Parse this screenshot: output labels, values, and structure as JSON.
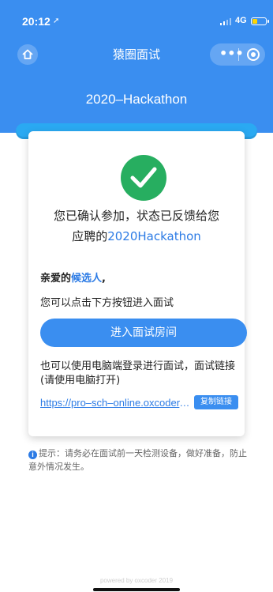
{
  "status_bar": {
    "time": "20:12",
    "network": "4G",
    "battery_level": 0.35
  },
  "nav": {
    "title": "猿圈面试",
    "home_icon": "home-icon",
    "more_icon": "more-dots-icon",
    "close_icon": "target-icon",
    "more_glyph": "•••"
  },
  "header": {
    "event_title": "2020–Hackathon"
  },
  "card": {
    "confirm_line1": "您已确认参加，状态已反馈给您",
    "confirm_prefix": "应聘的",
    "confirm_event": "2020Hackathon",
    "greeting_prefix": "亲爱的",
    "greeting_name": "候选人",
    "greeting_suffix": ",",
    "hint": "您可以点击下方按钮进入面试",
    "enter_button": "进入面试房间",
    "pc_note": "也可以使用电脑端登录进行面试，面试链接(请使用电脑打开)",
    "link_text": "https://pro–sch–online.oxcoder.com",
    "copy_button": "复制链接"
  },
  "tip": {
    "text": "提示：请务必在面试前一天检测设备，做好准备，防止意外情况发生。"
  },
  "footer": {
    "powered": "powered by oxcoder 2019"
  },
  "colors": {
    "primary": "#3a8ef0",
    "accent": "#2c7be5",
    "success": "#27ae60",
    "rail": "#2aa9f2"
  }
}
